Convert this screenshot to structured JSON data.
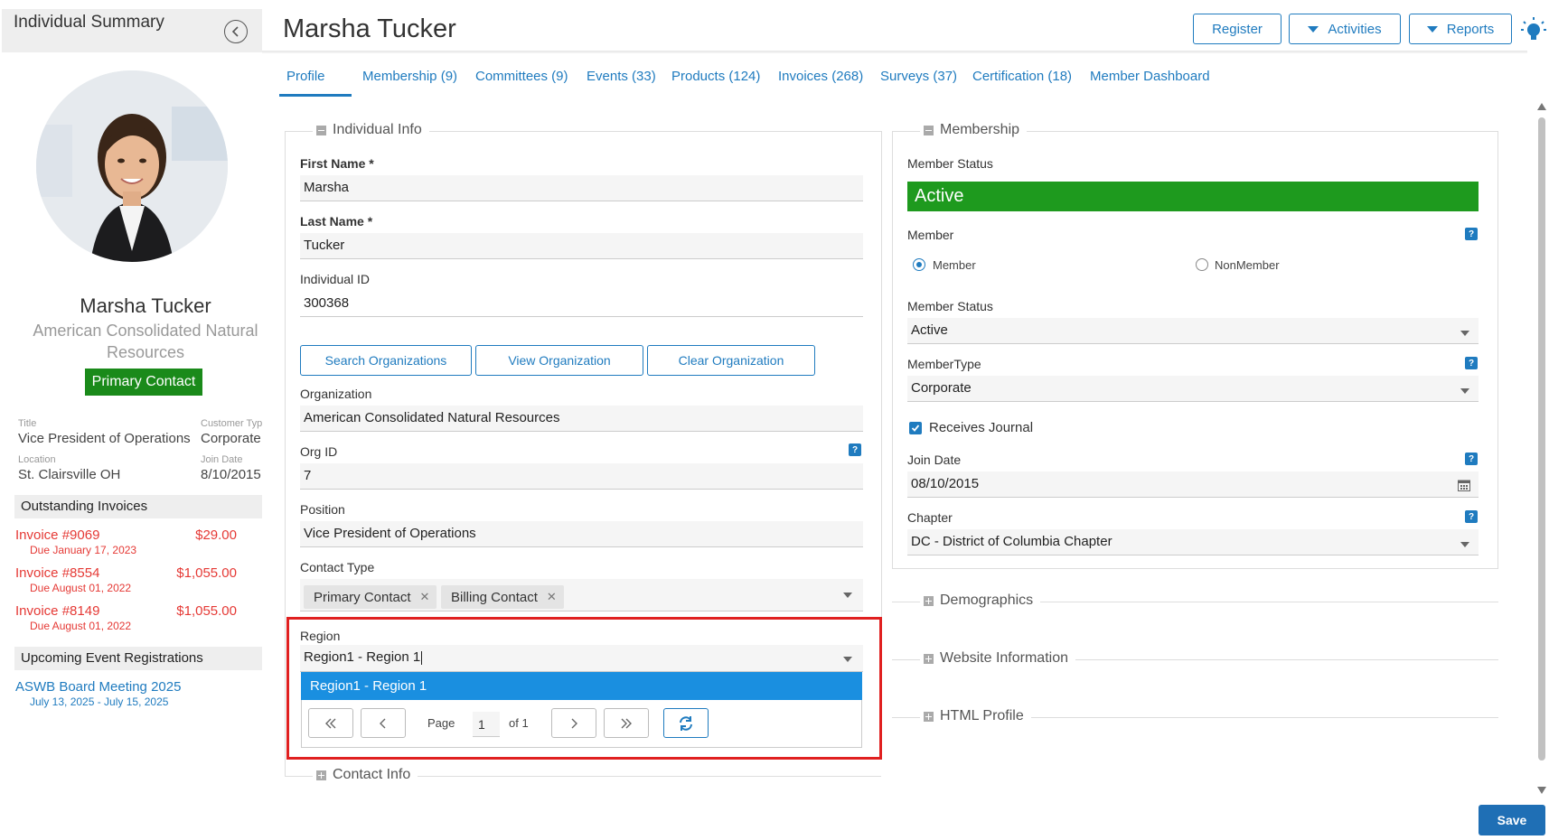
{
  "sidebar": {
    "title": "Individual Summary",
    "name": "Marsha Tucker",
    "org": "American Consolidated Natural Resources",
    "primary_badge": "Primary Contact",
    "title_label": "Title",
    "title_value": "Vice President of Operations",
    "customer_type_label": "Customer Typ",
    "customer_type_value": "Corporate",
    "location_label": "Location",
    "location_value": "St. Clairsville OH",
    "join_date_label": "Join Date",
    "join_date_value": "8/10/2015",
    "outstanding_invoices_title": "Outstanding Invoices",
    "invoices": [
      {
        "label": "Invoice #9069",
        "due": "Due January 17, 2023",
        "amount": "$29.00"
      },
      {
        "label": "Invoice #8554",
        "due": "Due August 01, 2022",
        "amount": "$1,055.00"
      },
      {
        "label": "Invoice #8149",
        "due": "Due August 01, 2022",
        "amount": "$1,055.00"
      }
    ],
    "upcoming_events_title": "Upcoming Event Registrations",
    "events": [
      {
        "label": "ASWB Board Meeting 2025",
        "dates": "July 13, 2025 - July 15, 2025"
      }
    ]
  },
  "header": {
    "title": "Marsha Tucker",
    "register_label": "Register",
    "activities_label": "Activities",
    "reports_label": "Reports"
  },
  "tabs": [
    {
      "label": "Profile"
    },
    {
      "label": "Membership (9)"
    },
    {
      "label": "Committees (9)"
    },
    {
      "label": "Events (33)"
    },
    {
      "label": "Products (124)"
    },
    {
      "label": "Invoices (268)"
    },
    {
      "label": "Surveys (37)"
    },
    {
      "label": "Certification (18)"
    },
    {
      "label": "Member Dashboard"
    }
  ],
  "individual_info": {
    "legend": "Individual Info",
    "first_name_label": "First Name *",
    "first_name": "Marsha",
    "last_name_label": "Last Name *",
    "last_name": "Tucker",
    "individual_id_label": "Individual ID",
    "individual_id": "300368",
    "search_org_label": "Search Organizations",
    "view_org_label": "View Organization",
    "clear_org_label": "Clear Organization",
    "organization_label": "Organization",
    "organization": "American Consolidated Natural Resources",
    "org_id_label": "Org ID",
    "org_id": "7",
    "position_label": "Position",
    "position": "Vice President of Operations",
    "contact_type_label": "Contact Type",
    "contact_types": [
      "Primary Contact",
      "Billing Contact"
    ],
    "region_label": "Region",
    "region_value": "Region1 - Region 1",
    "region_option": "Region1 - Region 1",
    "pager_page_label": "Page",
    "pager_page": "1",
    "pager_of": "of 1"
  },
  "contact_info_legend": "Contact Info",
  "membership": {
    "legend": "Membership",
    "status_label": "Member Status",
    "status_banner": "Active",
    "member_label": "Member",
    "radio_member": "Member",
    "radio_nonmember": "NonMember",
    "status2_label": "Member Status",
    "status2_value": "Active",
    "member_type_label": "MemberType",
    "member_type_value": "Corporate",
    "receives_journal": "Receives Journal",
    "join_date_label": "Join Date",
    "join_date_value": "08/10/2015",
    "chapter_label": "Chapter",
    "chapter_value": "DC - District of Columbia Chapter"
  },
  "collapsed_sections": {
    "demographics": "Demographics",
    "website": "Website Information",
    "html_profile": "HTML Profile"
  },
  "help_glyph": "?",
  "save_label": "Save",
  "colors": {
    "accent": "#1f7bbf",
    "active_green": "#1e9a1e",
    "invoice_red": "#e53935",
    "highlight_red": "#e02020"
  }
}
